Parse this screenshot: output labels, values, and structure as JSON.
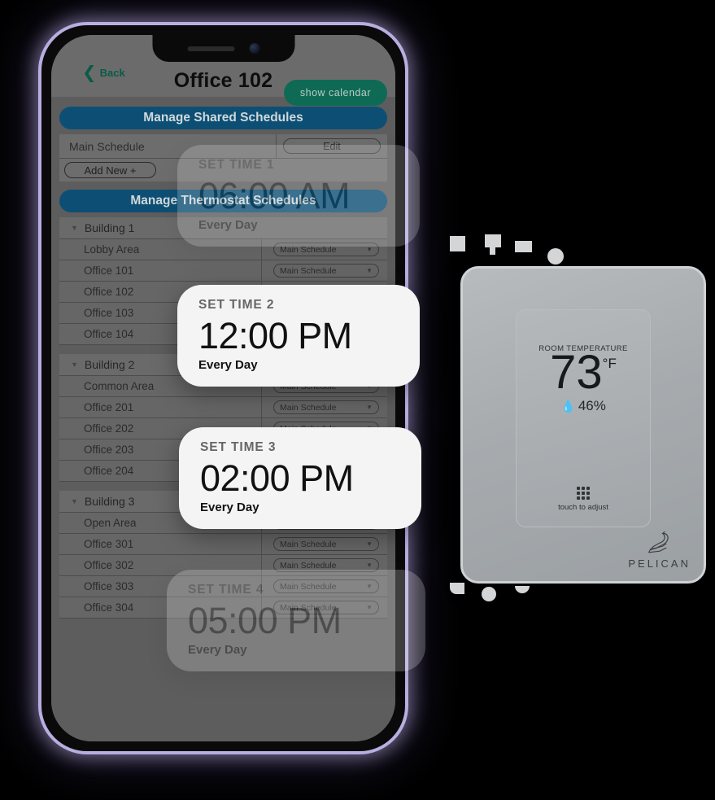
{
  "phone": {
    "header": {
      "back_label": "Back",
      "back_icon": "chevron-left-icon",
      "title": "Office 102",
      "show_calendar_label": "show calendar"
    },
    "shared_schedules": {
      "banner": "Manage Shared Schedules",
      "rows": [
        {
          "name": "Main Schedule",
          "action": "Edit"
        }
      ],
      "add_new_label": "Add New +"
    },
    "thermostat_schedules": {
      "banner": "Manage Thermostat Schedules",
      "select_value": "Main Schedule",
      "buildings": [
        {
          "label": "Building 1",
          "zones": [
            "Lobby Area",
            "Office 101",
            "Office 102",
            "Office 103",
            "Office 104"
          ]
        },
        {
          "label": "Building 2",
          "zones": [
            "Common Area",
            "Office 201",
            "Office 202",
            "Office 203",
            "Office 204"
          ]
        },
        {
          "label": "Building 3",
          "zones": [
            "Open Area",
            "Office 301",
            "Office 302",
            "Office 303",
            "Office 304"
          ]
        }
      ]
    }
  },
  "set_time_cards": [
    {
      "label": "SET TIME 1",
      "time": "06:00 AM",
      "days": "Every Day"
    },
    {
      "label": "SET TIME 2",
      "time": "12:00 PM",
      "days": "Every Day"
    },
    {
      "label": "SET TIME 3",
      "time": "02:00 PM",
      "days": "Every Day"
    },
    {
      "label": "SET TIME 4",
      "time": "05:00 PM",
      "days": "Every Day"
    }
  ],
  "thermostat": {
    "room_temp_label": "ROOM TEMPERATURE",
    "temperature": "73",
    "unit": "°F",
    "humidity_icon": "water-drop-icon",
    "humidity": "46%",
    "touch_label": "touch to adjust",
    "brand": "PELICAN"
  },
  "colors": {
    "banner_blue": "#0d4f74",
    "accent_green": "#0f6a55",
    "back_link_green": "#0c5a46",
    "phone_frame": "#b9aee0",
    "card_bg": "#f4f4f4"
  }
}
